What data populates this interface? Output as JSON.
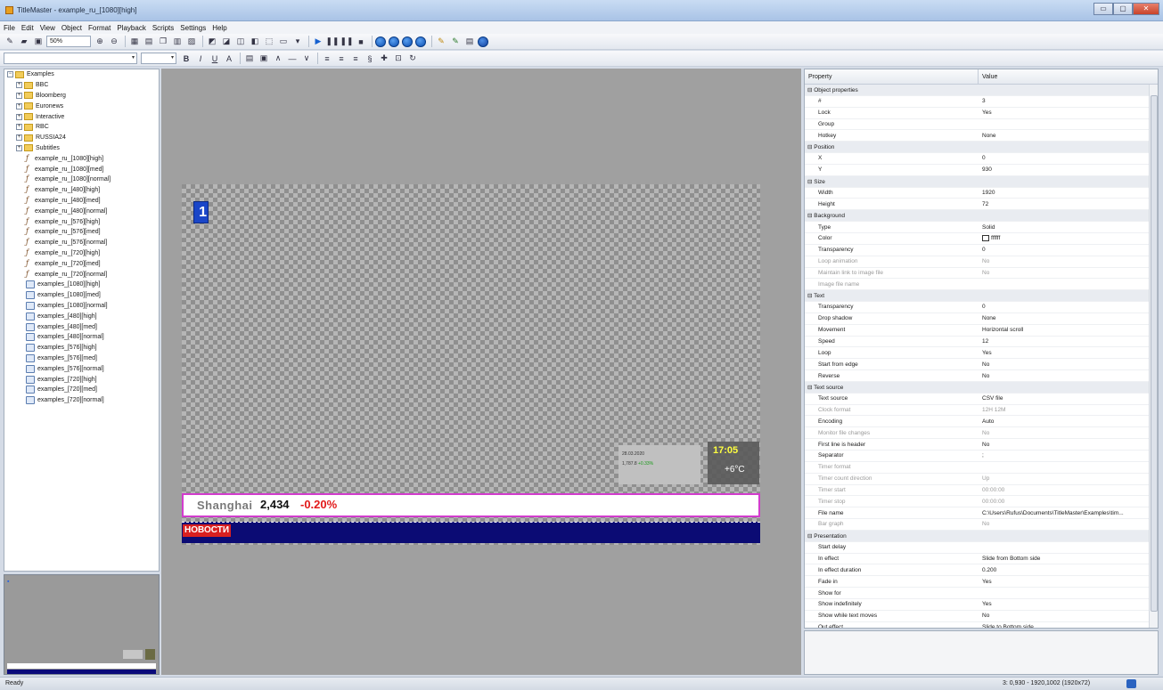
{
  "window": {
    "title": "TitleMaster - example_ru_[1080][high]",
    "buttons": [
      "▭",
      "▢",
      "✕"
    ]
  },
  "menu": [
    "File",
    "Edit",
    "View",
    "Object",
    "Format",
    "Playback",
    "Scripts",
    "Settings",
    "Help"
  ],
  "toolbar": {
    "zoom": "50%",
    "format_buttons": [
      "B",
      "I",
      "U",
      "A"
    ]
  },
  "tree": {
    "root": "Examples",
    "folders": [
      "BBC",
      "Bloomberg",
      "Euronews",
      "Interactive",
      "RBC",
      "RUSSIA24",
      "Subtitles"
    ],
    "titles": [
      "example_ru_[1080][high]",
      "example_ru_[1080][med]",
      "example_ru_[1080][normal]",
      "example_ru_[480][high]",
      "example_ru_[480][med]",
      "example_ru_[480][normal]",
      "example_ru_[576][high]",
      "example_ru_[576][med]",
      "example_ru_[576][normal]",
      "example_ru_[720][high]",
      "example_ru_[720][med]",
      "example_ru_[720][normal]"
    ],
    "schedules": [
      "examples_[1080][high]",
      "examples_[1080][med]",
      "examples_[1080][normal]",
      "examples_[480][high]",
      "examples_[480][med]",
      "examples_[480][normal]",
      "examples_[576][high]",
      "examples_[576][med]",
      "examples_[576][normal]",
      "examples_[720][high]",
      "examples_[720][med]",
      "examples_[720][normal]"
    ]
  },
  "canvas": {
    "logo_text": "1",
    "clock_time": "17:05",
    "clock_temp": "+6°C",
    "stock_date": "28.03.2020",
    "stock_index": "1,787.8",
    "stock_change": "+0.33%",
    "ticker_city": "Shanghai",
    "ticker_value": "2,434",
    "ticker_change": "-0.20%",
    "news_label": "НОВОСТИ",
    "ticker_border_color": "#d23ccd",
    "news_bar_color": "#0b0b74"
  },
  "props": {
    "header_property": "Property",
    "header_value": "Value",
    "rows": [
      {
        "k": "⊟ Object properties",
        "v": "",
        "cat": true
      },
      {
        "k": "#",
        "v": "3"
      },
      {
        "k": "Lock",
        "v": "Yes"
      },
      {
        "k": "Group",
        "v": ""
      },
      {
        "k": "Hotkey",
        "v": "None"
      },
      {
        "k": "⊟ Position",
        "v": "",
        "cat": true
      },
      {
        "k": "X",
        "v": "0"
      },
      {
        "k": "Y",
        "v": "930"
      },
      {
        "k": "⊟ Size",
        "v": "",
        "cat": true
      },
      {
        "k": "Width",
        "v": "1920"
      },
      {
        "k": "Height",
        "v": "72"
      },
      {
        "k": "⊟ Background",
        "v": "",
        "cat": true
      },
      {
        "k": "Type",
        "v": "Solid"
      },
      {
        "k": "Color",
        "v": "ffffff",
        "swatch": true
      },
      {
        "k": "Transparency",
        "v": "0"
      },
      {
        "k": "Loop animation",
        "v": "No",
        "dis": true
      },
      {
        "k": "Maintain link to image file",
        "v": "No",
        "dis": true
      },
      {
        "k": "Image file name",
        "v": "",
        "dis": true
      },
      {
        "k": "⊟ Text",
        "v": "",
        "cat": true
      },
      {
        "k": "Transparency",
        "v": "0"
      },
      {
        "k": "Drop shadow",
        "v": "None"
      },
      {
        "k": "Movement",
        "v": "Horizontal scroll"
      },
      {
        "k": "Speed",
        "v": "12"
      },
      {
        "k": "Loop",
        "v": "Yes"
      },
      {
        "k": "Start from edge",
        "v": "No"
      },
      {
        "k": "Reverse",
        "v": "No"
      },
      {
        "k": "⊟ Text source",
        "v": "",
        "cat": true
      },
      {
        "k": "Text source",
        "v": "CSV file"
      },
      {
        "k": "Clock format",
        "v": "12H 12M",
        "dis": true
      },
      {
        "k": "Encoding",
        "v": "Auto"
      },
      {
        "k": "Monitor file changes",
        "v": "No",
        "dis": true
      },
      {
        "k": "First line is header",
        "v": "No"
      },
      {
        "k": "Separator",
        "v": ";"
      },
      {
        "k": "Timer format",
        "v": "",
        "dis": true
      },
      {
        "k": "Timer count direction",
        "v": "Up",
        "dis": true
      },
      {
        "k": "Timer start",
        "v": "00:00:00",
        "dis": true
      },
      {
        "k": "Timer stop",
        "v": "00:00:00",
        "dis": true
      },
      {
        "k": "File name",
        "v": "C:\\Users\\Rufus\\Documents\\TitleMaster\\Examples\\tim..."
      },
      {
        "k": "Bar graph",
        "v": "No",
        "dis": true
      },
      {
        "k": "⊟ Presentation",
        "v": "",
        "cat": true
      },
      {
        "k": "Start delay",
        "v": ""
      },
      {
        "k": "In effect",
        "v": "Slide from Bottom side"
      },
      {
        "k": "In effect duration",
        "v": "0.200"
      },
      {
        "k": "Fade in",
        "v": "Yes"
      },
      {
        "k": "Show for",
        "v": ""
      },
      {
        "k": "Show indefinitely",
        "v": "Yes"
      },
      {
        "k": "Show while text moves",
        "v": "No"
      },
      {
        "k": "Out effect",
        "v": "Slide to Bottom side"
      }
    ]
  },
  "status": {
    "left": "Ready",
    "right": "3: 0,930 - 1920,1002 (1920x72)"
  }
}
